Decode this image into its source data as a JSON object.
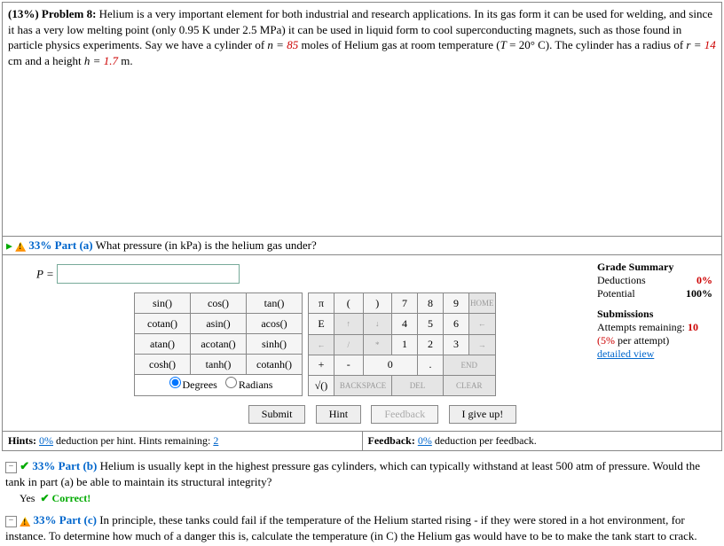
{
  "problem": {
    "label": "(13%)  Problem 8:",
    "text1": "  Helium is a very important element for both industrial and research applications. In its gas form it can be used for welding, and since it has a very low melting point (only 0.95 K under 2.5 MPa) it can be used in liquid form to cool superconducting magnets, such as those found in particle physics experiments. Say we have a cylinder of ",
    "n_label": "n = ",
    "n_val": "85",
    "text2": " moles of Helium gas at room temperature (",
    "T_label": "T",
    "T_eq": " = 20° C). The cylinder has a radius of ",
    "r_label": "r = ",
    "r_val": "14",
    "text3": " cm and a height ",
    "h_label": "h = ",
    "h_val": "1.7",
    "text4": " m."
  },
  "part_a": {
    "pct": "33% ",
    "label": "Part (a)",
    "q": "  What pressure (in kPa) is the helium gas under?",
    "var": "P = "
  },
  "grade": {
    "title": "Grade Summary",
    "ded_lbl": "Deductions",
    "ded_val": "0%",
    "pot_lbl": "Potential",
    "pot_val": "100%",
    "sub_title": "Submissions",
    "att_lbl": "Attempts remaining: ",
    "att_val": "10",
    "per": "(5%",
    "per2": " per attempt)",
    "detail": "detailed view"
  },
  "funcs": [
    [
      "sin()",
      "cos()",
      "tan()"
    ],
    [
      "cotan()",
      "asin()",
      "acos()"
    ],
    [
      "atan()",
      "acotan()",
      "sinh()"
    ],
    [
      "cosh()",
      "tanh()",
      "cotanh()"
    ]
  ],
  "mode": {
    "deg": "Degrees",
    "rad": "Radians"
  },
  "nums": [
    [
      "π",
      "(",
      ")",
      "7",
      "8",
      "9",
      "HOME"
    ],
    [
      "E",
      "↑",
      "↓",
      "4",
      "5",
      "6",
      "←"
    ],
    [
      "←",
      "/",
      "*",
      "1",
      "2",
      "3",
      "→"
    ],
    [
      "+",
      "-",
      "0",
      ".",
      "END"
    ],
    [
      "√()",
      "BACKSPACE",
      "DEL",
      "CLEAR"
    ]
  ],
  "actions": {
    "submit": "Submit",
    "hint": "Hint",
    "feedback": "Feedback",
    "giveup": "I give up!"
  },
  "hints": {
    "lbl": "Hints: ",
    "pct": "0%",
    "txt": " deduction per hint. Hints remaining: ",
    "rem": "2"
  },
  "fb": {
    "lbl": "Feedback: ",
    "pct": "0%",
    "txt": " deduction per feedback."
  },
  "part_b": {
    "pct": "33% ",
    "label": "Part (b)",
    "q": "  Helium is usually kept in the highest pressure gas cylinders, which can typically withstand at least 500 atm of pressure. Would the tank in part (a) be able to maintain its structural integrity?",
    "ans_lbl": "Yes",
    "correct": "✔ Correct!"
  },
  "part_c": {
    "pct": "33% ",
    "label": "Part (c)",
    "q": "  In principle, these tanks could fail if the temperature of the Helium started rising - if they were stored in a hot environment, for instance. To determine how much of a danger this is, calculate the temperature (in C) the Helium gas would have to be to make the tank start to crack."
  }
}
